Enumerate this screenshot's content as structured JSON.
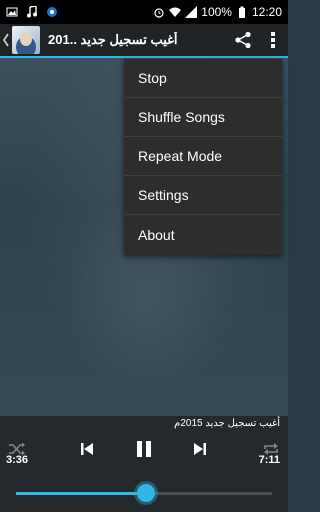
{
  "status_bar": {
    "battery": "100%",
    "time": "12:20"
  },
  "action_bar": {
    "title": "أغيب تسجيل جديد ..201",
    "icons": [
      "back-arrow-icon",
      "album-avatar",
      "share-icon",
      "overflow-menu-icon"
    ]
  },
  "menu": {
    "items": [
      {
        "label": "Stop"
      },
      {
        "label": "Shuffle Songs"
      },
      {
        "label": "Repeat Mode"
      },
      {
        "label": "Settings"
      },
      {
        "label": "About"
      }
    ]
  },
  "player": {
    "track_title": "أغيب تسجيل جديد 2015م",
    "elapsed": "3:36",
    "duration": "7:11",
    "progress": 0.508,
    "accent": "#33b5e5"
  }
}
